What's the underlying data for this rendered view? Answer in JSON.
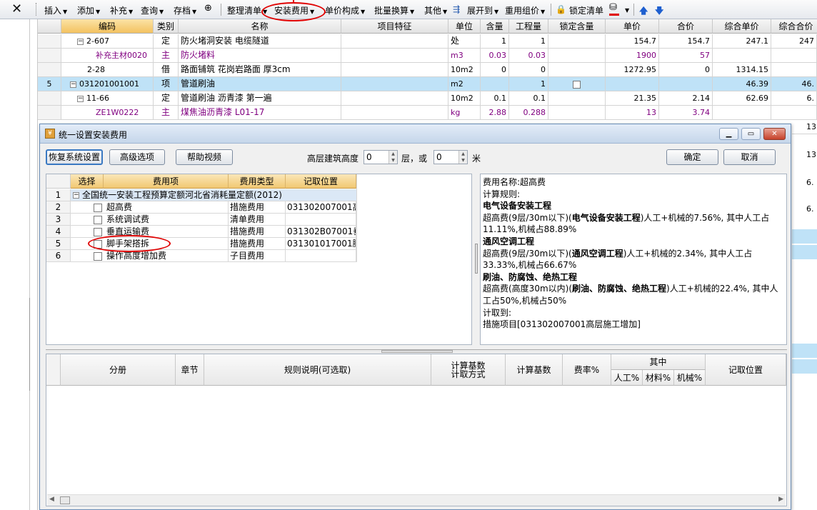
{
  "toolbar": {
    "close": "✕",
    "items": [
      {
        "label": "插入",
        "dropdown": true
      },
      {
        "label": "添加",
        "dropdown": true
      },
      {
        "label": "补充",
        "dropdown": true
      },
      {
        "label": "查询",
        "dropdown": true
      },
      {
        "label": "存档",
        "dropdown": true
      },
      {
        "label": "整理清单",
        "dropdown": true
      },
      {
        "label": "安装费用",
        "dropdown": true
      },
      {
        "label": "单价构成",
        "dropdown": true
      },
      {
        "label": "批量换算",
        "dropdown": true
      },
      {
        "label": "其他",
        "dropdown": true
      },
      {
        "label": "展开到",
        "dropdown": true
      },
      {
        "label": "重用组价",
        "dropdown": true
      },
      {
        "label": "锁定清单",
        "dropdown": false
      }
    ]
  },
  "grid": {
    "headers": [
      "编码",
      "类别",
      "名称",
      "项目特征",
      "单位",
      "含量",
      "工程量",
      "锁定含量",
      "单价",
      "合价",
      "综合单价",
      "综合合价"
    ],
    "rows": [
      {
        "no": "",
        "code": "2-607",
        "type": "定",
        "name": "防火堵洞安装 电缆隧道",
        "feature": "",
        "unit": "处",
        "qty": "1",
        "amount": "1",
        "lock": "",
        "price": "154.7",
        "total": "154.7",
        "cprice": "247.1",
        "ctotal": "247",
        "style": "normal",
        "toggle": "−"
      },
      {
        "no": "",
        "code": "补充主材0020",
        "type": "主",
        "name": "防火堵料",
        "feature": "",
        "unit": "m3",
        "qty": "0.03",
        "amount": "0.03",
        "lock": "",
        "price": "1900",
        "total": "57",
        "cprice": "",
        "ctotal": "",
        "style": "purple",
        "toggle": ""
      },
      {
        "no": "",
        "code": "2-28",
        "type": "借",
        "name": "路面铺筑 花岗岩路面 厚3cm",
        "feature": "",
        "unit": "10m2",
        "qty": "0",
        "amount": "0",
        "lock": "",
        "price": "1272.95",
        "total": "0",
        "cprice": "1314.15",
        "ctotal": "",
        "style": "normal",
        "toggle": ""
      },
      {
        "no": "5",
        "code": "031201001001",
        "type": "项",
        "name": "管道刷油",
        "feature": "",
        "unit": "m2",
        "qty": "",
        "amount": "1",
        "lock": "checkbox",
        "price": "",
        "total": "",
        "cprice": "46.39",
        "ctotal": "46.",
        "style": "highlight",
        "toggle": "−"
      },
      {
        "no": "",
        "code": "11-66",
        "type": "定",
        "name": "管道刷油 沥青漆 第一遍",
        "feature": "",
        "unit": "10m2",
        "qty": "0.1",
        "amount": "0.1",
        "lock": "",
        "price": "21.35",
        "total": "2.14",
        "cprice": "62.69",
        "ctotal": "6.",
        "style": "normal",
        "toggle": "−"
      },
      {
        "no": "",
        "code": "ZE1W0222",
        "type": "主",
        "name": "煤焦油沥青漆 L01-17",
        "feature": "",
        "unit": "kg",
        "qty": "2.88",
        "amount": "0.288",
        "lock": "",
        "price": "13",
        "total": "3.74",
        "cprice": "",
        "ctotal": "",
        "style": "purple",
        "toggle": ""
      }
    ],
    "right_edge_values": [
      "13.",
      "13.",
      "6.",
      "6."
    ]
  },
  "dialog": {
    "title": "统一设置安装费用",
    "buttons": {
      "restore": "恢复系统设置",
      "advanced": "高级选项",
      "help_video": "帮助视频",
      "ok": "确定",
      "cancel": "取消"
    },
    "height_label": "高层建筑高度",
    "height_value": "0",
    "floor_label": "层，或",
    "floor_value": "0",
    "meter_label": "米",
    "fee_table": {
      "headers": [
        "选择",
        "费用项",
        "费用类型",
        "记取位置"
      ],
      "group": {
        "no": "1",
        "label": "全国统一安装工程预算定额河北省消耗量定额(2012)"
      },
      "rows": [
        {
          "no": "2",
          "name": "超高费",
          "type": "措施费用",
          "position": "031302007001高"
        },
        {
          "no": "3",
          "name": "系统调试费",
          "type": "清单费用",
          "position": ""
        },
        {
          "no": "4",
          "name": "垂直运输费",
          "type": "措施费用",
          "position": "031302B07001垂"
        },
        {
          "no": "5",
          "name": "脚手架搭拆",
          "type": "措施费用",
          "position": "031301017001脚"
        },
        {
          "no": "6",
          "name": "操作高度增加费",
          "type": "子目费用",
          "position": ""
        }
      ]
    },
    "description": {
      "fee_name": "费用名称:超高费",
      "rule_label": "计算规则:",
      "sections": [
        {
          "title": "电气设备安装工程",
          "text_pre": "超高费(9层/30m以下)(",
          "text_bold": "电气设备安装工程",
          "text_post": ")人工+机械的7.56%, 其中人工占11.11%,机械占88.89%"
        },
        {
          "title": "通风空调工程",
          "text_pre": "超高费(9层/30m以下)(",
          "text_bold": "通风空调工程",
          "text_post": ")人工+机械的2.34%, 其中人工占33.33%,机械占66.67%"
        },
        {
          "title": "刷油、防腐蚀、绝热工程",
          "text_pre": "超高费(高度30m以内)(",
          "text_bold": "刷油、防腐蚀、绝热工程",
          "text_post": ")人工+机械的22.4%, 其中人工占50%,机械占50%"
        }
      ],
      "accrue_label": "计取到:",
      "accrue_value": "措施项目[031302007001高层施工增加]"
    },
    "bottom_table": {
      "headers": {
        "division": "分册",
        "chapter": "章节",
        "rule": "规则说明(可选取)",
        "calc_method": "计算基数\n计取方式",
        "calc_base": "计算基数",
        "rate": "费率%",
        "of_which": "其中",
        "labor": "人工%",
        "material": "材料%",
        "machine": "机械%",
        "position": "记取位置"
      }
    }
  },
  "colors": {
    "annotation_red": "#e00000",
    "highlight_row": "#bfe2f7",
    "header_orange": "#f1c872",
    "purple_text": "#800080"
  }
}
